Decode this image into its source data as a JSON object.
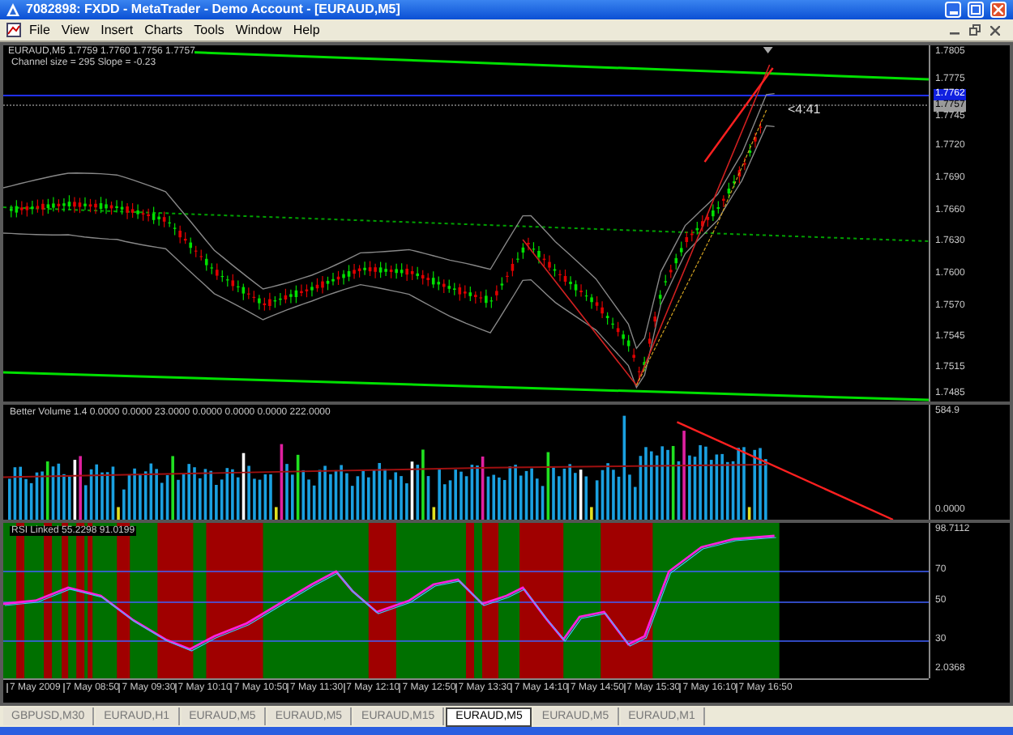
{
  "window": {
    "title": "7082898: FXDD - MetaTrader - Demo Account - [EURAUD,M5]"
  },
  "menu": [
    "File",
    "View",
    "Insert",
    "Charts",
    "Tools",
    "Window",
    "Help"
  ],
  "price_panel": {
    "header": "EURAUD,M5  1.7759 1.7760 1.7756 1.7757",
    "subheader": "Channel size = 295 Slope = -0.23",
    "countdown": "<4:41",
    "axis_labels": [
      {
        "text": "1.7805",
        "kind": "plain"
      },
      {
        "text": "1.7775",
        "kind": "plain"
      },
      {
        "text": "1.7762",
        "kind": "line"
      },
      {
        "text": "1.7757",
        "kind": "bid"
      },
      {
        "text": "1.7745",
        "kind": "plain"
      },
      {
        "text": "1.7720",
        "kind": "plain"
      },
      {
        "text": "1.7690",
        "kind": "plain"
      },
      {
        "text": "1.7660",
        "kind": "plain"
      },
      {
        "text": "1.7630",
        "kind": "plain"
      },
      {
        "text": "1.7600",
        "kind": "plain"
      },
      {
        "text": "1.7570",
        "kind": "plain"
      },
      {
        "text": "1.7545",
        "kind": "plain"
      },
      {
        "text": "1.7515",
        "kind": "plain"
      },
      {
        "text": "1.7485",
        "kind": "plain"
      }
    ]
  },
  "volume_panel": {
    "title": "Better Volume 1.4 0.0000 0.0000 23.0000 0.0000 0.0000 0.0000 222.0000",
    "axis_labels": [
      "584.9",
      "0.0000"
    ]
  },
  "rsi_panel": {
    "title": "RSI Linked 55.2298 91.0199",
    "axis_labels": [
      "98.7112",
      "70",
      "50",
      "30",
      "2.0368"
    ]
  },
  "time_axis": [
    "7 May 2009",
    "7 May 08:50",
    "7 May 09:30",
    "7 May 10:10",
    "7 May 10:50",
    "7 May 11:30",
    "7 May 12:10",
    "7 May 12:50",
    "7 May 13:30",
    "7 May 14:10",
    "7 May 14:50",
    "7 May 15:30",
    "7 May 16:10",
    "7 May 16:50"
  ],
  "tabs": [
    {
      "label": "GBPUSD,M30",
      "selected": false
    },
    {
      "label": "EURAUD,H1",
      "selected": false
    },
    {
      "label": "EURAUD,M5",
      "selected": false
    },
    {
      "label": "EURAUD,M5",
      "selected": false
    },
    {
      "label": "EURAUD,M15",
      "selected": false
    },
    {
      "label": "EURAUD,M5",
      "selected": true
    },
    {
      "label": "EURAUD,M5",
      "selected": false
    },
    {
      "label": "EURAUD,M1",
      "selected": false
    }
  ]
}
